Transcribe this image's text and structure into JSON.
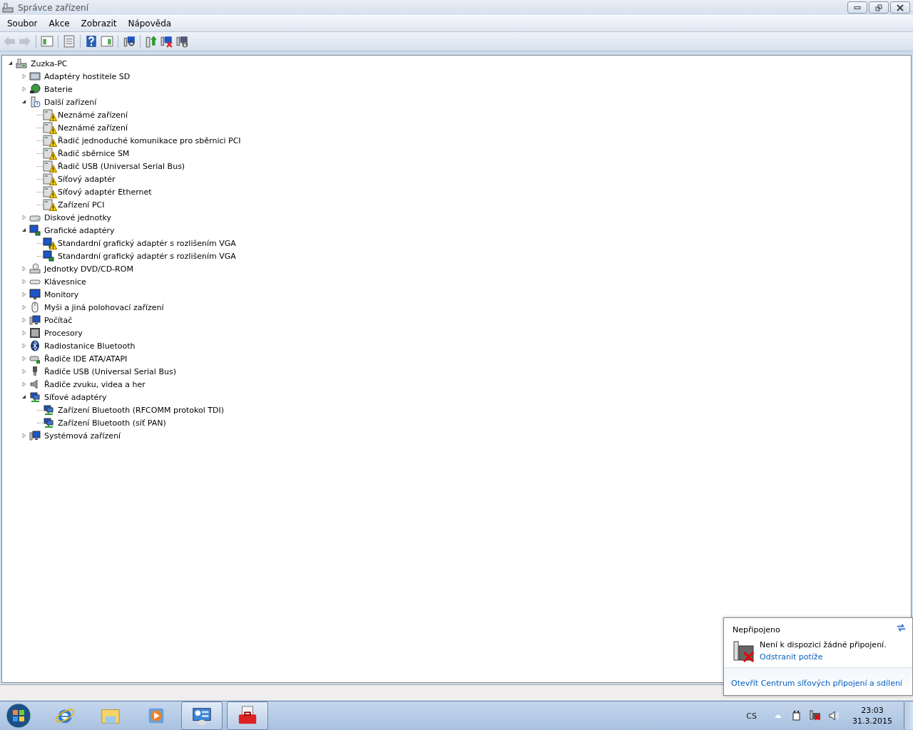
{
  "window": {
    "title": "Správce zařízení"
  },
  "menu": [
    "Soubor",
    "Akce",
    "Zobrazit",
    "Nápověda"
  ],
  "toolbar": [
    {
      "kind": "back",
      "disabled": true
    },
    {
      "kind": "forward",
      "disabled": true
    },
    {
      "kind": "sep"
    },
    {
      "kind": "tree"
    },
    {
      "kind": "sep"
    },
    {
      "kind": "properties"
    },
    {
      "kind": "sep"
    },
    {
      "kind": "help"
    },
    {
      "kind": "pane"
    },
    {
      "kind": "sep"
    },
    {
      "kind": "scan"
    },
    {
      "kind": "sep"
    },
    {
      "kind": "update"
    },
    {
      "kind": "disable"
    },
    {
      "kind": "uninstall"
    }
  ],
  "tree": {
    "label": "Zuzka-PC",
    "kind": "computer",
    "expanded": true,
    "children": [
      {
        "label": "Adaptéry hostitele SD",
        "kind": "card",
        "expanded": false
      },
      {
        "label": "Baterie",
        "kind": "battery",
        "expanded": false
      },
      {
        "label": "Další zařízení",
        "kind": "unknown",
        "expanded": true,
        "children": [
          {
            "label": "Neznámé zařízení",
            "kind": "device",
            "warning": true
          },
          {
            "label": "Neznámé zařízení",
            "kind": "device",
            "warning": true
          },
          {
            "label": "Řadič jednoduché komunikace pro sběrnici PCI",
            "kind": "device",
            "warning": true
          },
          {
            "label": "Řadič sběrnice SM",
            "kind": "device",
            "warning": true
          },
          {
            "label": "Řadič USB (Universal Serial Bus)",
            "kind": "device",
            "warning": true
          },
          {
            "label": "Síťový adaptér",
            "kind": "device",
            "warning": true
          },
          {
            "label": "Síťový adaptér Ethernet",
            "kind": "device",
            "warning": true
          },
          {
            "label": "Zařízení PCI",
            "kind": "device",
            "warning": true
          }
        ]
      },
      {
        "label": "Diskové jednotky",
        "kind": "disk",
        "expanded": false
      },
      {
        "label": "Grafické adaptéry",
        "kind": "display",
        "expanded": true,
        "children": [
          {
            "label": "Standardní grafický adaptér s rozlišením VGA",
            "kind": "display",
            "warning": true
          },
          {
            "label": "Standardní grafický adaptér s rozlišením VGA",
            "kind": "display",
            "warning": false
          }
        ]
      },
      {
        "label": "Jednotky DVD/CD-ROM",
        "kind": "dvd",
        "expanded": false
      },
      {
        "label": "Klávesnice",
        "kind": "keyboard",
        "expanded": false
      },
      {
        "label": "Monitory",
        "kind": "monitor",
        "expanded": false
      },
      {
        "label": "Myši a jiná polohovací zařízení",
        "kind": "mouse",
        "expanded": false
      },
      {
        "label": "Počítač",
        "kind": "pc",
        "expanded": false
      },
      {
        "label": "Procesory",
        "kind": "cpu",
        "expanded": false
      },
      {
        "label": "Radiostanice Bluetooth",
        "kind": "bluetooth",
        "expanded": false
      },
      {
        "label": "Řadiče IDE ATA/ATAPI",
        "kind": "ide",
        "expanded": false
      },
      {
        "label": "Řadiče USB (Universal Serial Bus)",
        "kind": "usb",
        "expanded": false
      },
      {
        "label": "Řadiče zvuku, videa a her",
        "kind": "sound",
        "expanded": false
      },
      {
        "label": "Síťové adaptéry",
        "kind": "network",
        "expanded": true,
        "children": [
          {
            "label": "Zařízení Bluetooth (RFCOMM protokol TDI)",
            "kind": "network",
            "warning": false
          },
          {
            "label": "Zařízení Bluetooth (síť PAN)",
            "kind": "network",
            "warning": false
          }
        ]
      },
      {
        "label": "Systémová zařízení",
        "kind": "pc",
        "expanded": false
      }
    ]
  },
  "popup": {
    "title": "Nepřipojeno",
    "message": "Není k dispozici žádné připojení.",
    "link": "Odstranit potíže",
    "footer_link": "Otevřít Centrum síťových připojení a sdílení"
  },
  "taskbar": {
    "apps": [
      {
        "kind": "browser",
        "running": false
      },
      {
        "kind": "folder",
        "running": false
      },
      {
        "kind": "media",
        "running": false
      },
      {
        "kind": "control",
        "running": true
      },
      {
        "kind": "toolbox",
        "running": true
      }
    ],
    "language": "CS",
    "time": "23:03",
    "date": "31.3.2015"
  }
}
